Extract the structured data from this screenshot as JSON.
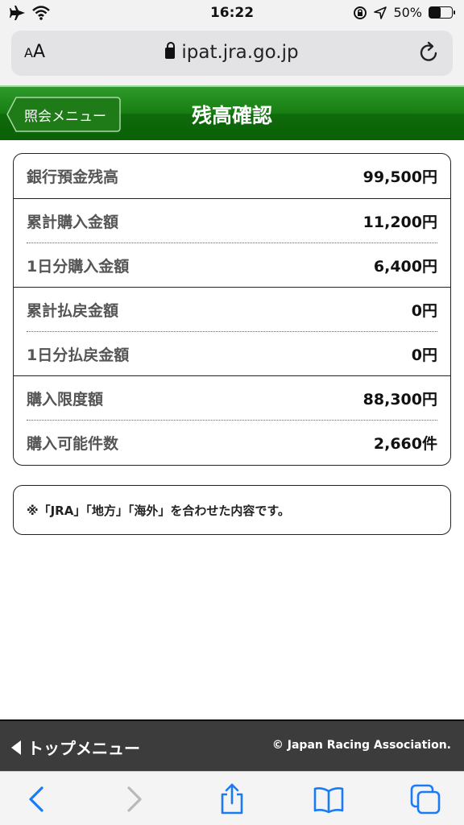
{
  "status_bar": {
    "time": "16:22",
    "battery": "50%",
    "battery_level": 0.5
  },
  "browser": {
    "url": "ipat.jra.go.jp",
    "aa_small": "A",
    "aa_large": "A"
  },
  "header": {
    "back_label": "照会メニュー",
    "title": "残高確認"
  },
  "balance": {
    "rows": [
      {
        "label": "銀行預金残高",
        "value": "99,500円"
      },
      {
        "label": "累計購入金額",
        "value": "11,200円"
      },
      {
        "label": "1日分購入金額",
        "value": "6,400円"
      },
      {
        "label": "累計払戻金額",
        "value": "0円"
      },
      {
        "label": "1日分払戻金額",
        "value": "0円"
      },
      {
        "label": "購入限度額",
        "value": "88,300円"
      },
      {
        "label": "購入可能件数",
        "value": "2,660件"
      }
    ]
  },
  "note": {
    "text": "※「JRA」「地方」「海外」を合わせた内容です。"
  },
  "footer": {
    "top_menu_label": "トップメニュー",
    "copyright": "© Japan Racing Association."
  },
  "colors": {
    "header_green": "#177d12",
    "footer_bg": "#3c3c3c",
    "link_blue": "#1a7cf5"
  },
  "icons": [
    "airplane-icon",
    "wifi-icon",
    "orientation-lock-icon",
    "location-icon",
    "battery-icon",
    "lock-icon",
    "reload-icon",
    "back-arrow-icon",
    "forward-arrow-icon",
    "share-icon",
    "bookmarks-icon",
    "tabs-icon"
  ]
}
